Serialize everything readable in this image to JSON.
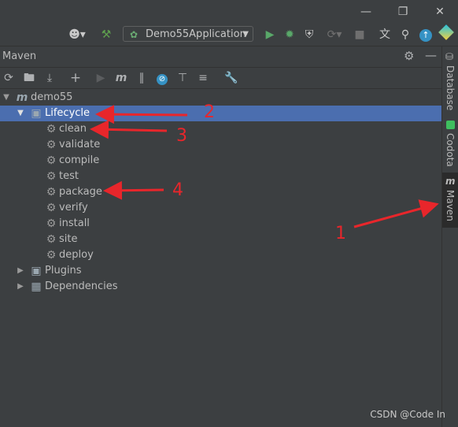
{
  "window": {
    "minimize_icon": "minimize-icon",
    "restore_icon": "restore-icon",
    "close_icon": "close-icon"
  },
  "toolbar": {
    "run_config": "Demo55Application",
    "icons": [
      "user-icon",
      "hammer-icon",
      "run-icon",
      "debug-icon",
      "coverage-icon",
      "profile-icon",
      "stop-icon",
      "translate-icon",
      "search-icon",
      "update-icon",
      "plugin-icon"
    ]
  },
  "panel": {
    "title": "Maven",
    "settings_icon": "gear-icon",
    "hide_icon": "minimize-icon"
  },
  "maven_toolbar": {
    "icons": [
      "reload-icon",
      "add-folder-icon",
      "download-icon",
      "plus-icon",
      "run-icon",
      "maven-goal-icon",
      "toggle-offline-icon",
      "skip-tests-icon",
      "show-dependencies-icon",
      "collapse-icon",
      "settings-wrench-icon"
    ]
  },
  "tree": {
    "root": "demo55",
    "lifecycle_label": "Lifecycle",
    "lifecycle": [
      "clean",
      "validate",
      "compile",
      "test",
      "package",
      "verify",
      "install",
      "site",
      "deploy"
    ],
    "plugins_label": "Plugins",
    "dependencies_label": "Dependencies"
  },
  "right_tabs": [
    "Database",
    "Codota",
    "Maven"
  ],
  "annotations": [
    "1",
    "2",
    "3",
    "4"
  ],
  "annotation_color": "#e8262b",
  "selection_color": "#4b6eaf",
  "watermark": "CSDN @Code In"
}
